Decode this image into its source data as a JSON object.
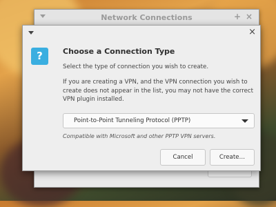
{
  "background_window": {
    "title": "Network Connections",
    "controls": [
      "+",
      "×"
    ],
    "close_label": "Close"
  },
  "dialog": {
    "heading": "Choose a Connection Type",
    "intro": "Select the type of connection you wish to create.",
    "vpn_note": "If you are creating a VPN, and the VPN connection you wish to create does not appear in the list, you may not have the correct VPN plugin installed.",
    "selected_type": "Point-to-Point Tunneling Protocol (PPTP)",
    "compatibility_note": "Compatible with Microsoft and other PPTP VPN servers.",
    "cancel_label": "Cancel",
    "create_label": "Create…",
    "close_glyph": "×",
    "help_glyph": "?"
  },
  "colors": {
    "accent": "#3aaee0"
  }
}
